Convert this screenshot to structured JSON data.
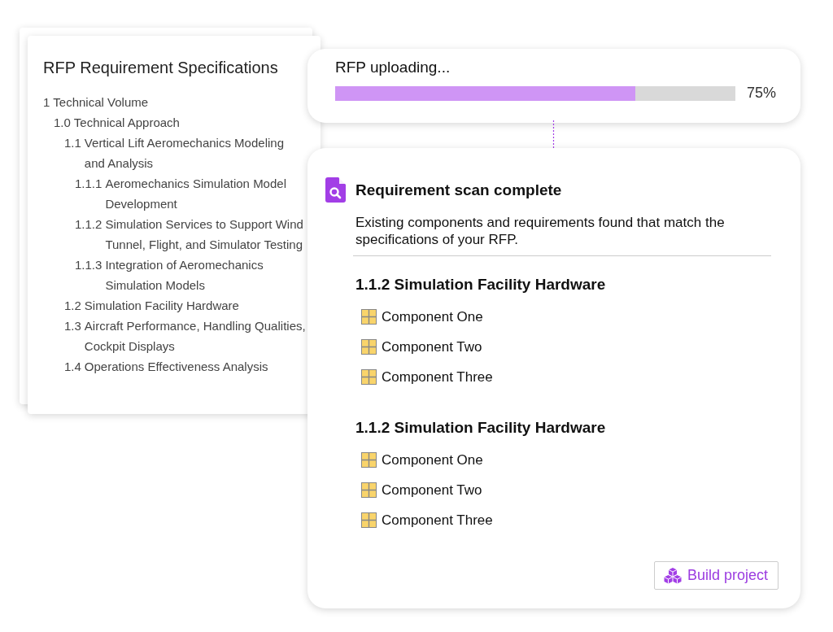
{
  "spec_card": {
    "title": "RFP Requirement Specifications",
    "outline": [
      {
        "number": "1",
        "title": "Technical Volume",
        "children": [
          {
            "number": "1.0",
            "title": "Technical Approach",
            "children": [
              {
                "number": "1.1",
                "title": "Vertical Lift Aeromechanics Modeling and Analysis",
                "children": [
                  {
                    "number": "1.1.1",
                    "title": "Aeromechanics Simulation Model Development"
                  },
                  {
                    "number": "1.1.2",
                    "title": "Simulation Services to Support Wind Tunnel, Flight, and Simulator Testing"
                  },
                  {
                    "number": "1.1.3",
                    "title": "Integration of Aeromechanics Simulation Models"
                  }
                ]
              },
              {
                "number": "1.2",
                "title": "Simulation Facility Hardware"
              },
              {
                "number": "1.3",
                "title": "Aircraft Performance, Handling Qualities, Cockpit Displays"
              },
              {
                "number": "1.4",
                "title": "Operations Effectiveness Analysis"
              }
            ]
          }
        ]
      }
    ]
  },
  "upload_card": {
    "label": "RFP uploading...",
    "level": 0.75,
    "percent": "75%"
  },
  "scan_card": {
    "title": "Requirement scan complete",
    "description": "Existing components and requirements found that match the specifications of your RFP.",
    "sections": [
      {
        "heading": "1.1.2 Simulation Facility Hardware",
        "components": [
          "Component One",
          "Component Two",
          "Component Three"
        ]
      },
      {
        "heading": "1.1.2 Simulation Facility Hardware",
        "components": [
          "Component One",
          "Component Two",
          "Component Three"
        ]
      }
    ],
    "button": "Build project"
  }
}
